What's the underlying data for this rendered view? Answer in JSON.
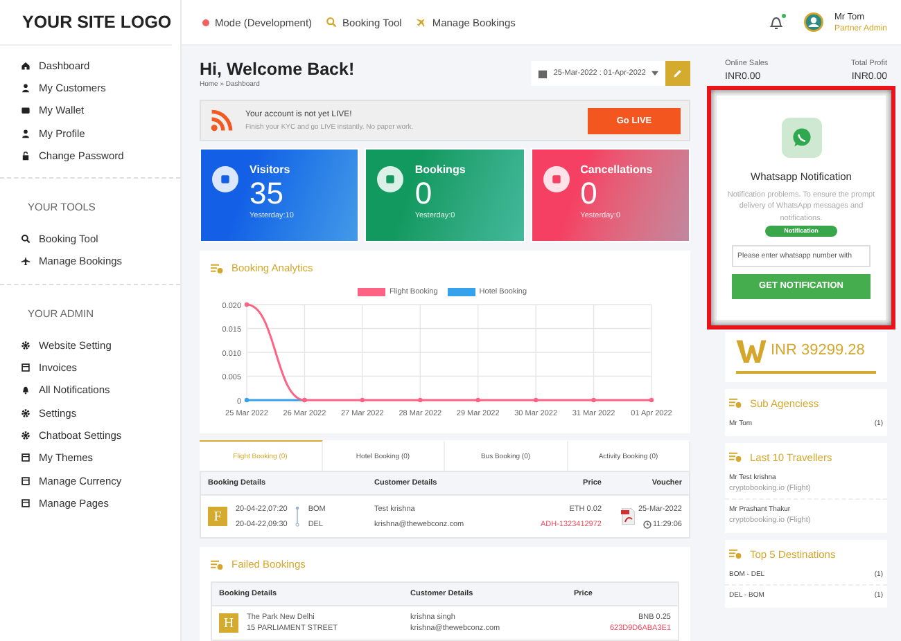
{
  "logo": "YOUR SITE LOGO",
  "topnav": [
    {
      "kind": "dot",
      "label": "Mode (Development)"
    },
    {
      "kind": "search",
      "label": "Booking Tool"
    },
    {
      "kind": "plane",
      "label": "Manage Bookings"
    }
  ],
  "user": {
    "name": "Mr Tom",
    "role": "Partner Admin",
    "has_notification": true
  },
  "sidebar": {
    "sections": [
      {
        "items": [
          {
            "label": "Dashboard"
          },
          {
            "label": "My Customers"
          },
          {
            "label": "My Wallet"
          },
          {
            "label": "My Profile"
          },
          {
            "label": "Change Password"
          }
        ]
      },
      {
        "heading": "YOUR TOOLS",
        "items": [
          {
            "label": "Booking Tool"
          },
          {
            "label": "Manage Bookings"
          }
        ]
      },
      {
        "heading": "YOUR ADMIN",
        "items": [
          {
            "label": "Website Setting"
          },
          {
            "label": "Invoices"
          },
          {
            "label": "All Notifications"
          },
          {
            "label": "Settings"
          },
          {
            "label": "Chatboat Settings"
          },
          {
            "label": "My Themes"
          },
          {
            "label": "Manage Currency"
          },
          {
            "label": "Manage Pages"
          }
        ]
      }
    ]
  },
  "page": {
    "title": "Hi, Welcome Back!",
    "breadcrumb": "Home » Dashboard",
    "date_range": "25-Mar-2022 : 01-Apr-2022"
  },
  "alert": {
    "title": "Your account is not yet LIVE!",
    "text": "Finish your KYC and go LIVE instantly. No paper work.",
    "button": "Go LIVE"
  },
  "stats": [
    {
      "label": "Visitors",
      "value": "35",
      "yesterday": "Yesterday:10",
      "color": "#1360e6"
    },
    {
      "label": "Bookings",
      "value": "0",
      "yesterday": "Yesterday:0",
      "color": "#11995f"
    },
    {
      "label": "Cancellations",
      "value": "0",
      "yesterday": "Yesterday:0",
      "color": "#f53f63"
    }
  ],
  "analytics": {
    "title": "Booking Analytics",
    "chart_data": {
      "type": "line",
      "grid": true,
      "categories": [
        "25 Mar 2022",
        "26 Mar 2022",
        "27 Mar 2022",
        "28 Mar 2022",
        "29 Mar 2022",
        "30 Mar 2022",
        "31 Mar 2022",
        "01 Apr 2022"
      ],
      "series": [
        {
          "name": "Flight Booking",
          "color": "#ff6384",
          "marker": "circle",
          "values": [
            0.02,
            0,
            0,
            0,
            0,
            0,
            0,
            0
          ]
        },
        {
          "name": "Hotel Booking",
          "color": "#36a2eb",
          "marker": "circle",
          "values": [
            0,
            0,
            null,
            null,
            null,
            null,
            null,
            null
          ]
        }
      ],
      "ylim": [
        0,
        0.02
      ],
      "yticks": [
        {
          "value": 0,
          "label": "0"
        },
        {
          "value": 0.005,
          "label": "0.005"
        },
        {
          "value": 0.01,
          "label": "0.010"
        },
        {
          "value": 0.015,
          "label": "0.015"
        },
        {
          "value": 0.02,
          "label": "0.020"
        }
      ]
    }
  },
  "tabs": [
    {
      "label": "Flight Booking (0)",
      "selected": true
    },
    {
      "label": "Hotel Booking (0)",
      "selected": false
    },
    {
      "label": "Bus Booking (0)",
      "selected": false
    },
    {
      "label": "Activity Booking (0)",
      "selected": false
    }
  ],
  "bookings": {
    "columns": [
      "Booking Details",
      "Customer Details",
      "Price",
      "Voucher"
    ],
    "rows": [
      {
        "letter": "F",
        "depart": "20-04-22,07:20",
        "arrive": "20-04-22,09:30",
        "from": "BOM",
        "to": "DEL",
        "customer": "Test krishna",
        "email": "krishna@thewebconz.com",
        "price": "ETH 0.02",
        "reference": "ADH-1323412972",
        "voucher_date": "25-Mar-2022",
        "voucher_time": "11:29:06"
      }
    ]
  },
  "failed": {
    "title": "Failed Bookings",
    "columns": [
      "Booking Details",
      "Customer Details",
      "Price"
    ],
    "rows": [
      {
        "letter": "H",
        "hotel": "The Park New Delhi",
        "address": "15 PARLIAMENT STREET",
        "customer": "krishna singh",
        "email": "krishna@thewebconz.com",
        "price": "BNB 0.25",
        "reference": "623D9D6ABA3E1"
      }
    ]
  },
  "summary": [
    {
      "label": "Online Sales",
      "value": "INR0.00"
    },
    {
      "label": "Total Profit",
      "value": "INR0.00"
    }
  ],
  "wallet": {
    "amount": "INR 39299.28"
  },
  "sub_agencies": {
    "title": "Sub Agenciess",
    "rows": [
      {
        "name": "Mr Tom",
        "count": "(1)"
      }
    ]
  },
  "travellers": {
    "title": "Last 10 Travellers",
    "rows": [
      {
        "name": "Mr Test krishna",
        "site": "cryptobooking.io (Flight)"
      },
      {
        "name": "Mr Prashant Thakur",
        "site": "cryptobooking.io (Flight)"
      }
    ]
  },
  "destinations": {
    "title": "Top 5 Destinations",
    "rows": [
      {
        "name": "BOM - DEL",
        "count": "(1)"
      },
      {
        "name": "DEL - BOM",
        "count": "(1)"
      }
    ]
  },
  "popup": {
    "title": "Whatsapp Notification",
    "text": "Notification problems. To ensure the prompt delivery of WhatsApp messages and notifications.",
    "badge": "Notification",
    "placeholder": "Please enter whatsapp number with",
    "button": "GET NOTIFICATION"
  }
}
